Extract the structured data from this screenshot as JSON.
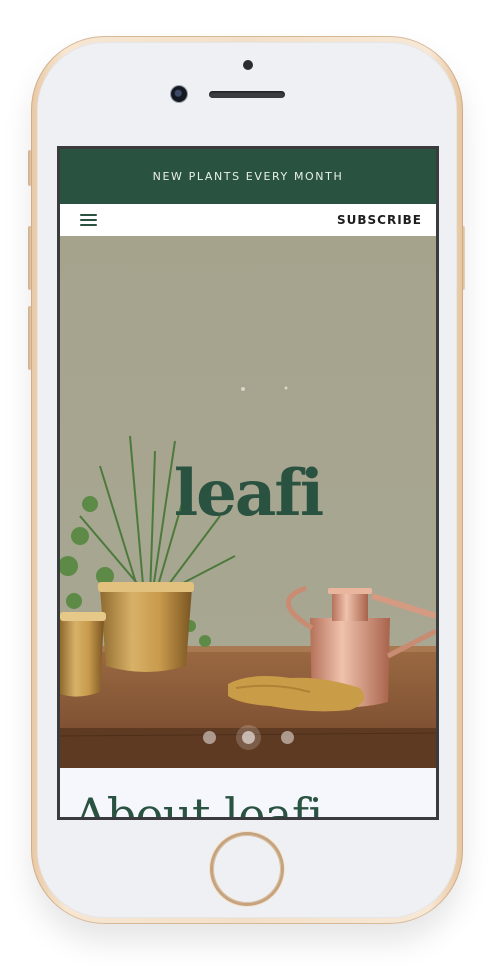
{
  "announcement": {
    "text": "NEW PLANTS EVERY MONTH"
  },
  "nav": {
    "menu_icon": "hamburger-menu-icon",
    "subscribe_label": "SUBSCRIBE"
  },
  "hero": {
    "logo_text": "leafi",
    "carousel": {
      "slide_count": 3,
      "active_index": 1
    }
  },
  "about": {
    "title": "About leafi"
  },
  "colors": {
    "brand_green": "#2a5240",
    "hero_wall": "#a8a58f",
    "about_bg": "#f6f7fc"
  }
}
